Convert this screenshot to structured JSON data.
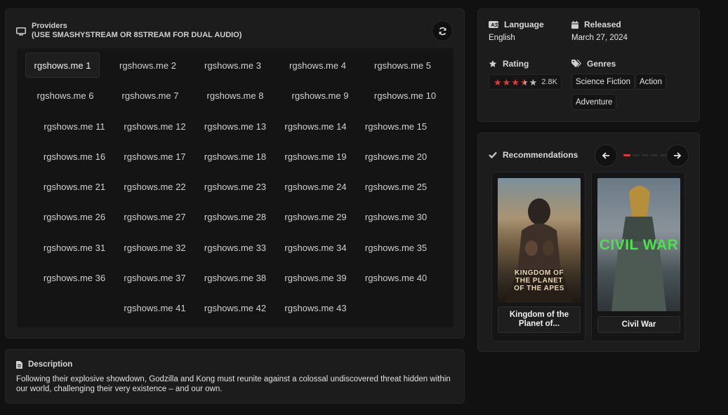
{
  "providers": {
    "title": "Providers",
    "subtitle": "(USE SMASHYSTREAM OR 8STREAM FOR DUAL AUDIO)",
    "refresh_icon": "refresh-icon",
    "servers": [
      "rgshows.me 1",
      "rgshows.me 2",
      "rgshows.me 3",
      "rgshows.me 4",
      "rgshows.me 5",
      "rgshows.me 6",
      "rgshows.me 7",
      "rgshows.me 8",
      "rgshows.me 9",
      "rgshows.me 10",
      "rgshows.me 11",
      "rgshows.me 12",
      "rgshows.me 13",
      "rgshows.me 14",
      "rgshows.me 15",
      "rgshows.me 16",
      "rgshows.me 17",
      "rgshows.me 18",
      "rgshows.me 19",
      "rgshows.me 20",
      "rgshows.me 21",
      "rgshows.me 22",
      "rgshows.me 23",
      "rgshows.me 24",
      "rgshows.me 25",
      "rgshows.me 26",
      "rgshows.me 27",
      "rgshows.me 28",
      "rgshows.me 29",
      "rgshows.me 30",
      "rgshows.me 31",
      "rgshows.me 32",
      "rgshows.me 33",
      "rgshows.me 34",
      "rgshows.me 35",
      "rgshows.me 36",
      "rgshows.me 37",
      "rgshows.me 38",
      "rgshows.me 39",
      "rgshows.me 40",
      "rgshows.me 41",
      "rgshows.me 42",
      "rgshows.me 43"
    ],
    "active_server": "rgshows.me 1"
  },
  "description": {
    "title": "Description",
    "text": "Following their explosive showdown, Godzilla and Kong must reunite against a colossal undiscovered threat hidden within our world, challenging their very existence – and our own."
  },
  "info": {
    "language_label": "Language",
    "language_value": "English",
    "released_label": "Released",
    "released_value": "March 27, 2024",
    "rating_label": "Rating",
    "rating_stars": 3.5,
    "rating_count": "2.8K",
    "genres_label": "Genres",
    "genres": [
      "Science Fiction",
      "Action",
      "Adventure"
    ]
  },
  "recommendations": {
    "title": "Recommendations",
    "items": [
      {
        "title": "Kingdom of the Planet of...",
        "poster_text": "KINGDOM OF THE PLANET OF THE APES"
      },
      {
        "title": "Civil War",
        "poster_text": "CIVIL WAR"
      }
    ],
    "accent": "#e53935"
  }
}
